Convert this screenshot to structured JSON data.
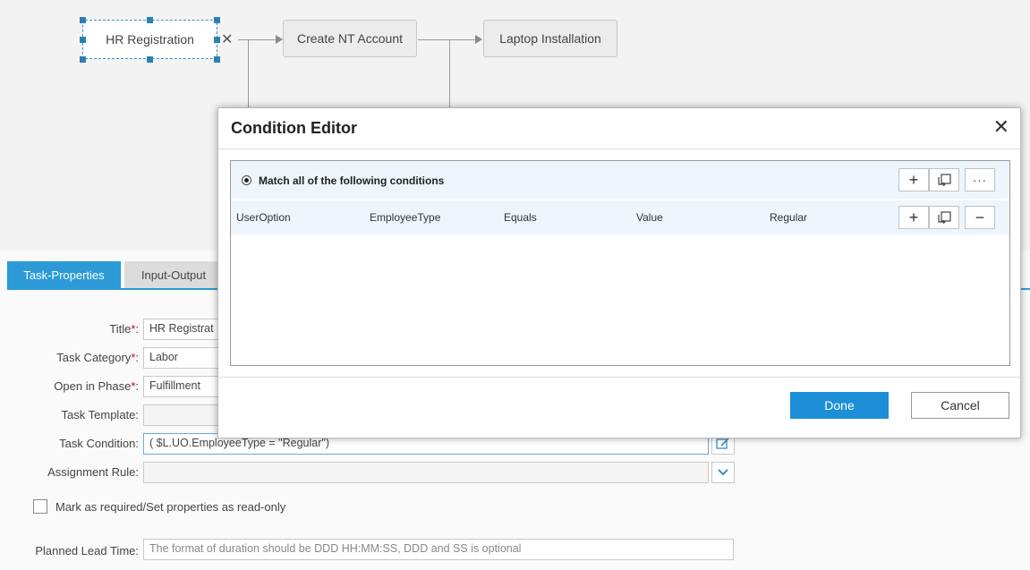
{
  "workflow": {
    "nodes": [
      "HR Registration",
      "Create NT Account",
      "Laptop Installation"
    ]
  },
  "tabs": [
    "Task-Properties",
    "Input-Output"
  ],
  "form": {
    "title_label": "Title",
    "title_value": "HR Registrat",
    "task_category_label": "Task Category",
    "task_category_value": "Labor",
    "open_in_phase_label": "Open in Phase",
    "open_in_phase_value": "Fulfillment",
    "task_template_label": "Task Template:",
    "task_condition_label": "Task Condition:",
    "task_condition_value": "( $L.UO.EmployeeType = \"Regular\")",
    "assignment_rule_label": "Assignment Rule:",
    "mark_required_label": "Mark as required/Set properties as read-only",
    "planned_lead_time_label": "Planned Lead Time:",
    "planned_lead_time_placeholder": "The format of duration should be DDD HH:MM:SS, DDD and SS is optional",
    "required_marker": "*",
    "colon": ":"
  },
  "dialog": {
    "title": "Condition Editor",
    "close_symbol": "✕",
    "group_label": "Match all of the following conditions",
    "condition": {
      "source": "UserOption",
      "field": "EmployeeType",
      "operator": "Equals",
      "value_type": "Value",
      "value": "Regular"
    },
    "done_label": "Done",
    "cancel_label": "Cancel",
    "icons": {
      "add": "+",
      "more": "···",
      "remove": "−"
    }
  },
  "colors": {
    "accent": "#1c8fd6",
    "tab_active": "#2b9ad6",
    "required": "#d0021b"
  }
}
